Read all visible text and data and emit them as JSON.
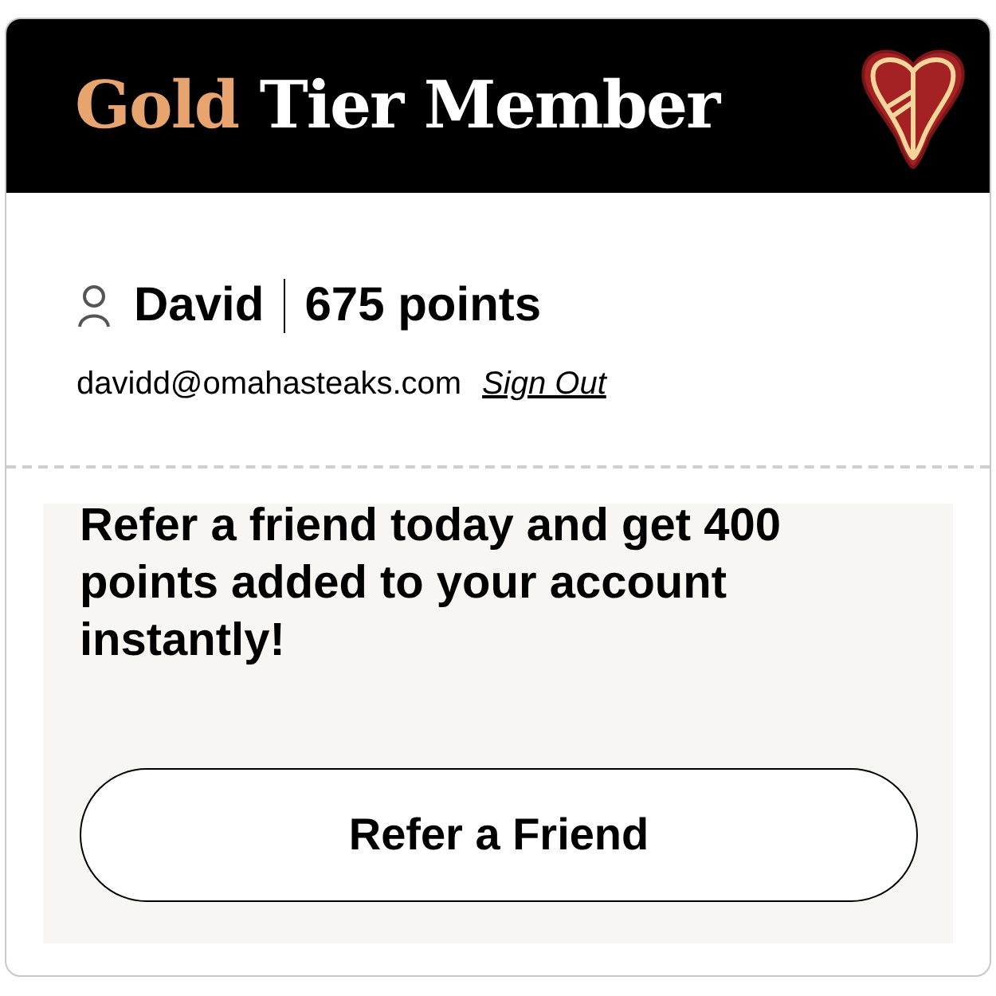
{
  "header": {
    "tier": "Gold",
    "title": "Tier Member"
  },
  "user": {
    "name": "David",
    "points": "675 points",
    "email": "davidd@omahasteaks.com",
    "sign_out": "Sign Out"
  },
  "referral": {
    "message": "Refer a friend today and get 400 points added to your account instantly!",
    "button": "Refer a Friend"
  }
}
